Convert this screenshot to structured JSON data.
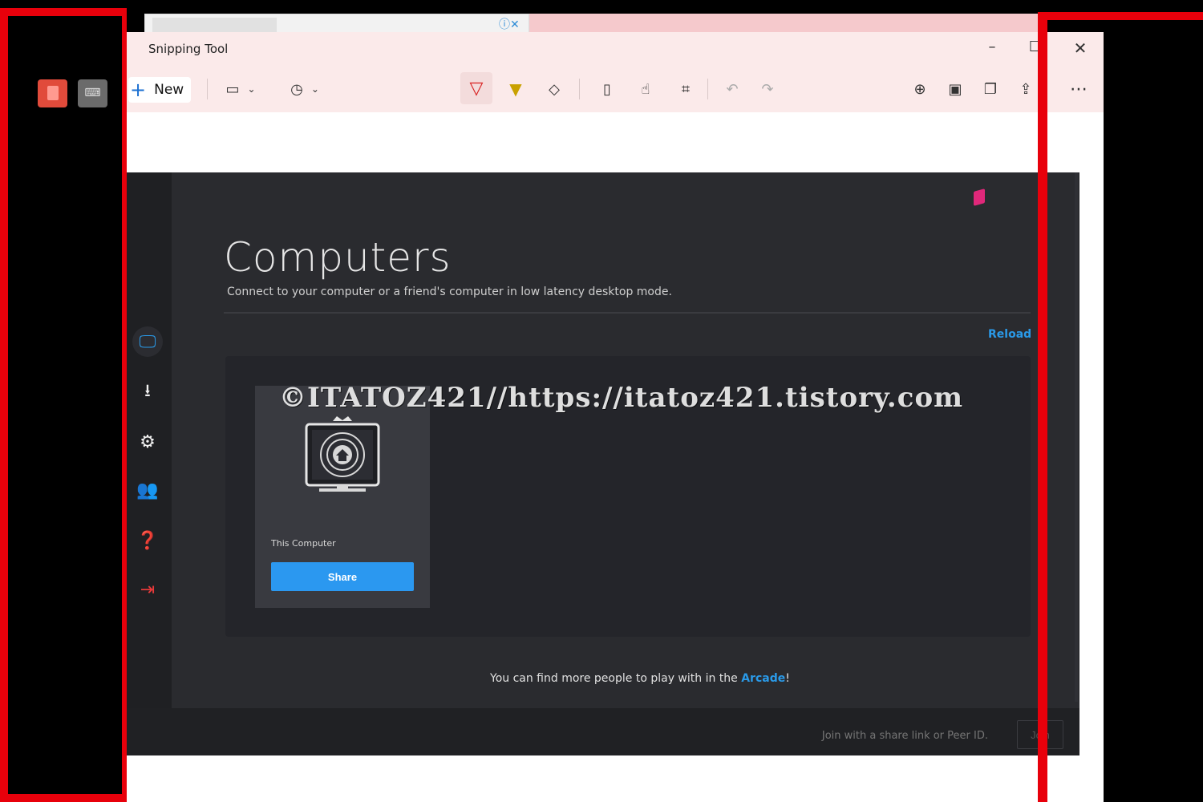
{
  "window": {
    "title": "Snipping Tool",
    "icons": {
      "app": "snipping-tool-icon",
      "minimize": "minimize-icon",
      "maximize": "maximize-icon",
      "close": "close-icon"
    }
  },
  "toolbar": {
    "new_label": "New",
    "tools": [
      "snipping-mode",
      "delay-timer",
      "ballpoint-pen",
      "highlighter",
      "eraser",
      "ruler",
      "touch-writing",
      "crop",
      "undo",
      "redo",
      "zoom",
      "save",
      "copy",
      "share",
      "see-more"
    ]
  },
  "app": {
    "page_title": "Computers",
    "page_subtitle": "Connect to your computer or a friend's computer in low latency desktop mode.",
    "reload_label": "Reload",
    "card": {
      "label": "This Computer",
      "share_label": "Share"
    },
    "arcade_text": "You can find more people to play with in the ",
    "arcade_link": "Arcade",
    "arcade_suffix": "!",
    "join_placeholder": "Join with a share link or Peer ID.",
    "join_label": "Join",
    "sidebar": [
      "computers",
      "download",
      "settings",
      "friends",
      "help",
      "logout"
    ]
  },
  "watermark": "©ITATOZ421//https://itatoz421.tistory.com",
  "colors": {
    "accent": "#2a9ae8",
    "frame_red": "#e8000b",
    "logout_red": "#e83a3a",
    "logo_pink": "#e0287a"
  }
}
